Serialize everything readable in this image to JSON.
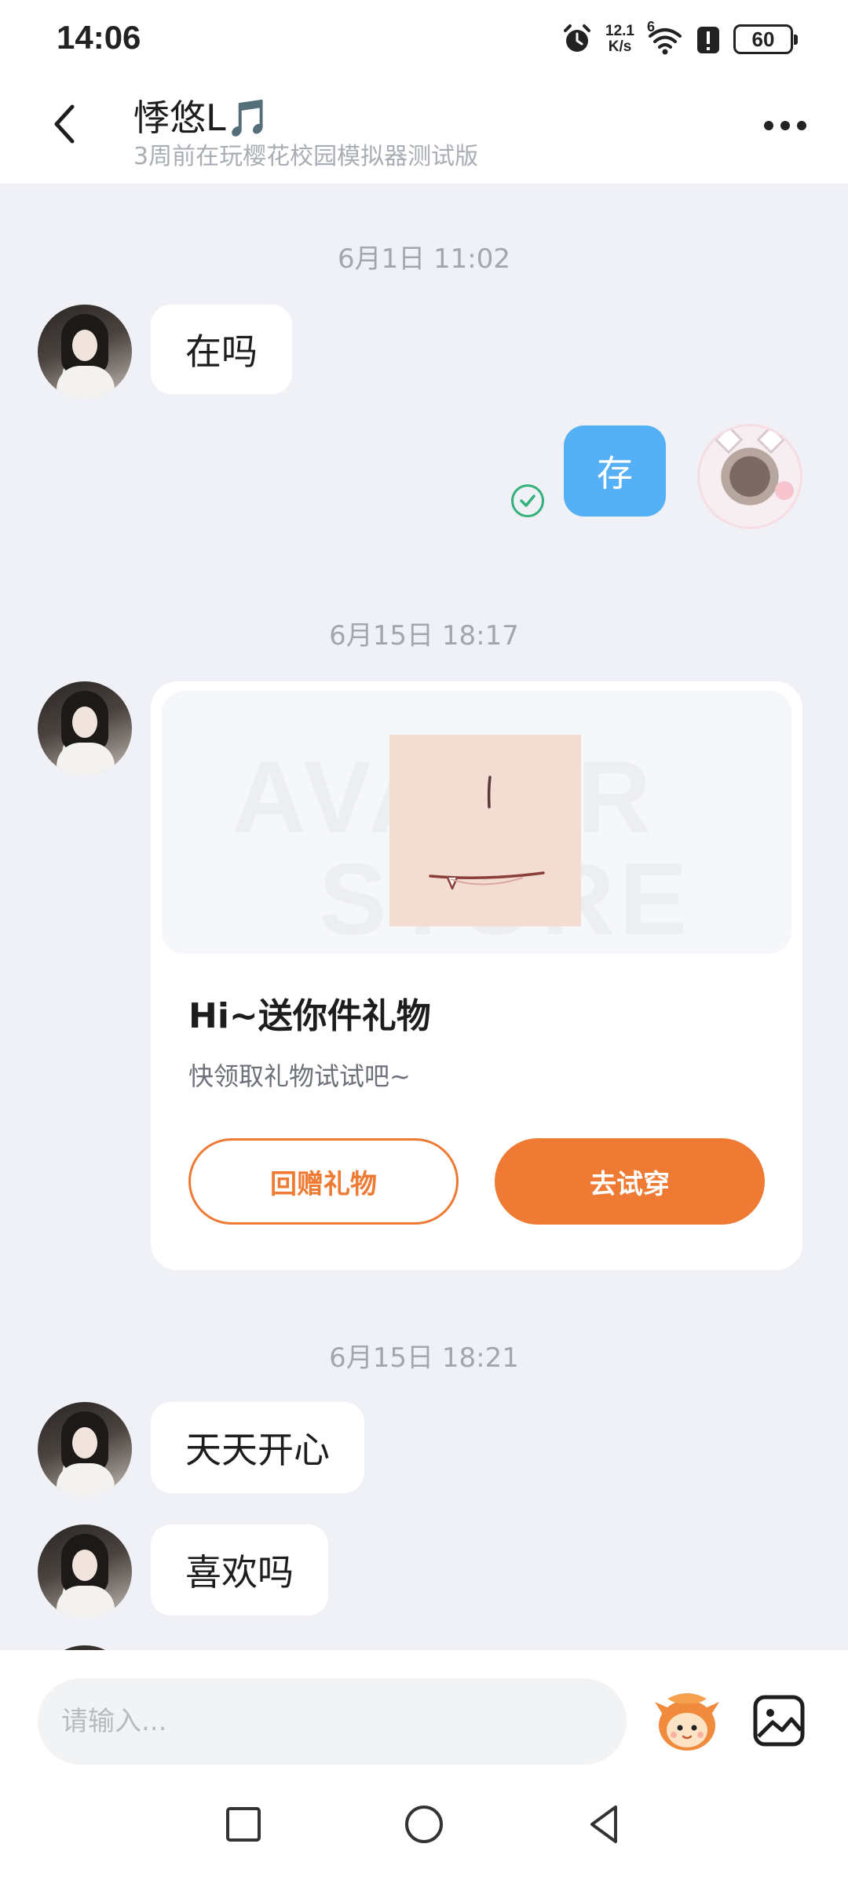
{
  "status_bar": {
    "time": "14:06",
    "net_speed_value": "12.1",
    "net_speed_unit": "K/s",
    "signal_label": "6",
    "battery": "60",
    "icons": [
      "alarm-icon",
      "wifi-icon",
      "alert-icon",
      "battery-icon"
    ]
  },
  "header": {
    "contact_name": "悸悠L🎵",
    "contact_status": "3周前在玩樱花校园模拟器测试版",
    "back_icon": "chevron-left-icon",
    "more_icon": "more-dots-icon"
  },
  "messages": {
    "timestamp_1": "6月1日 11:02",
    "msg_1": "在吗",
    "reply_1": "存",
    "timestamp_2": "6月15日 18:17",
    "gift": {
      "watermark_1": "AVATAR",
      "watermark_2": "STORE",
      "title": "Hi~送你件礼物",
      "description": "快领取礼物试试吧~",
      "return_button": "回赠礼物",
      "try_button": "去试穿"
    },
    "timestamp_3": "6月15日 18:21",
    "msg_2": "天天开心",
    "msg_3": "喜欢吗"
  },
  "input_bar": {
    "placeholder": "请输入..."
  },
  "colors": {
    "accent": "#ee7a33",
    "my_bubble": "#55b0f5",
    "read_check": "#34b07a",
    "background": "#eff1f6"
  }
}
